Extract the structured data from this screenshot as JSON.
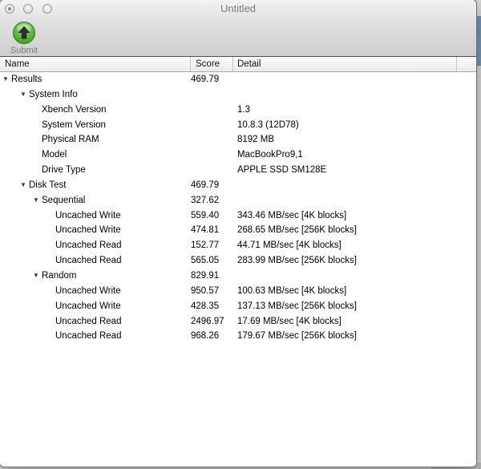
{
  "window": {
    "title": "Untitled",
    "traffic_lights": {
      "close": "close-button",
      "minimize": "minimize-button",
      "zoom": "zoom-button",
      "close_modified_dot": true
    },
    "toolbar": {
      "submit_label": "Submit"
    }
  },
  "table": {
    "columns": [
      "Name",
      "Score",
      "Detail"
    ],
    "rows": [
      {
        "level": 0,
        "expandable": true,
        "name": "Results",
        "score": "469.79",
        "detail": ""
      },
      {
        "level": 1,
        "expandable": true,
        "name": "System Info",
        "score": "",
        "detail": ""
      },
      {
        "level": 2,
        "expandable": false,
        "name": "Xbench Version",
        "score": "",
        "detail": "1.3"
      },
      {
        "level": 2,
        "expandable": false,
        "name": "System Version",
        "score": "",
        "detail": "10.8.3 (12D78)"
      },
      {
        "level": 2,
        "expandable": false,
        "name": "Physical RAM",
        "score": "",
        "detail": "8192 MB"
      },
      {
        "level": 2,
        "expandable": false,
        "name": "Model",
        "score": "",
        "detail": "MacBookPro9,1"
      },
      {
        "level": 2,
        "expandable": false,
        "name": "Drive Type",
        "score": "",
        "detail": "APPLE SSD SM128E"
      },
      {
        "level": 1,
        "expandable": true,
        "name": "Disk Test",
        "score": "469.79",
        "detail": ""
      },
      {
        "level": 2,
        "expandable": true,
        "name": "Sequential",
        "score": "327.62",
        "detail": ""
      },
      {
        "level": 3,
        "expandable": false,
        "name": "Uncached Write",
        "score": "559.40",
        "detail": "343.46 MB/sec [4K blocks]"
      },
      {
        "level": 3,
        "expandable": false,
        "name": "Uncached Write",
        "score": "474.81",
        "detail": "268.65 MB/sec [256K blocks]"
      },
      {
        "level": 3,
        "expandable": false,
        "name": "Uncached Read",
        "score": "152.77",
        "detail": "44.71 MB/sec [4K blocks]"
      },
      {
        "level": 3,
        "expandable": false,
        "name": "Uncached Read",
        "score": "565.05",
        "detail": "283.99 MB/sec [256K blocks]"
      },
      {
        "level": 2,
        "expandable": true,
        "name": "Random",
        "score": "829.91",
        "detail": ""
      },
      {
        "level": 3,
        "expandable": false,
        "name": "Uncached Write",
        "score": "950.57",
        "detail": "100.63 MB/sec [4K blocks]"
      },
      {
        "level": 3,
        "expandable": false,
        "name": "Uncached Write",
        "score": "428.35",
        "detail": "137.13 MB/sec [256K blocks]"
      },
      {
        "level": 3,
        "expandable": false,
        "name": "Uncached Read",
        "score": "2496.97",
        "detail": "17.69 MB/sec [4K blocks]"
      },
      {
        "level": 3,
        "expandable": false,
        "name": "Uncached Read",
        "score": "968.26",
        "detail": "179.67 MB/sec [256K blocks]"
      }
    ]
  },
  "colors": {
    "submit_green": "#5cb53e",
    "submit_green_light": "#aede8e",
    "submit_green_dark": "#358c1e",
    "toolbar_divider": "#515151",
    "background_blue_sliver": "#7296bc",
    "inactive_title_text": "#7c7c7c"
  }
}
